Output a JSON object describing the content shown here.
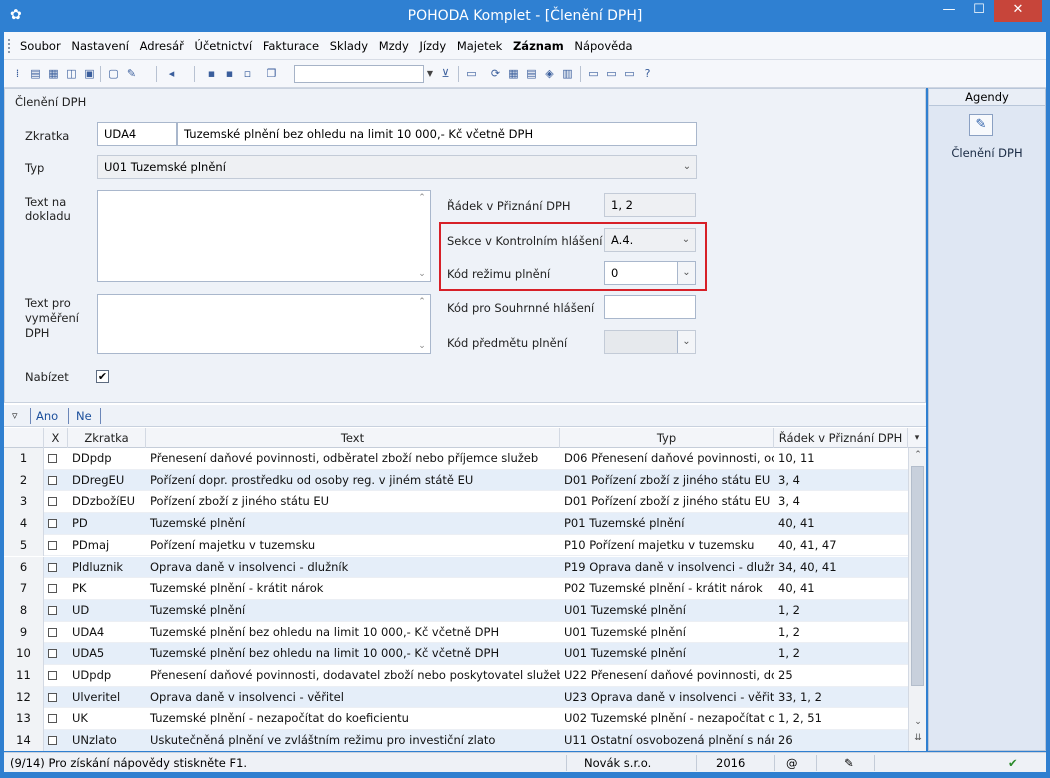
{
  "window": {
    "title": "POHODA Komplet - [Členění DPH]",
    "min": "—",
    "max": "☐",
    "close": "✕"
  },
  "menu": [
    "Soubor",
    "Nastavení",
    "Adresář",
    "Účetnictví",
    "Fakturace",
    "Sklady",
    "Mzdy",
    "Jízdy",
    "Majetek",
    "Záznam",
    "Nápověda"
  ],
  "form": {
    "heading": "Členění DPH",
    "zkratka_label": "Zkratka",
    "zkratka_value": "UDA4",
    "text_value": "Tuzemské plnění bez ohledu na limit 10 000,- Kč včetně DPH",
    "typ_label": "Typ",
    "typ_value": "U01 Tuzemské plnění",
    "text_na_dokladu_label": "Text na dokladu",
    "text_pro_vymereni_label": "Text pro vyměření DPH",
    "nabizet_label": "Nabízet",
    "nabizet_checked": "✔",
    "radek_label": "Řádek v Přiznání DPH",
    "radek_value": "1, 2",
    "sekce_label": "Sekce v Kontrolním hlášení",
    "sekce_value": "A.4.",
    "kod_rezimu_label": "Kód režimu plnění",
    "kod_rezimu_value": "0",
    "kod_souhrnne_label": "Kód pro Souhrnné hlášení",
    "kod_souhrnne_value": "",
    "kod_predmetu_label": "Kód předmětu plnění",
    "kod_predmetu_value": ""
  },
  "filter": {
    "ano": "Ano",
    "ne": "Ne"
  },
  "table": {
    "headers": [
      "X",
      "Zkratka",
      "Text",
      "Typ",
      "Řádek v Přiznání DPH"
    ],
    "rows": [
      {
        "n": "1",
        "zkratka": "DDpdp",
        "text": "Přenesení daňové povinnosti, odběratel zboží nebo příjemce služeb",
        "typ": "D06 Přenesení daňové povinnosti, oc",
        "radek": "10, 11"
      },
      {
        "n": "2",
        "zkratka": "DDregEU",
        "text": "Pořízení dopr. prostředku od osoby reg. v jiném státě EU",
        "typ": "D01 Pořízení zboží z jiného státu EU",
        "radek": "3, 4"
      },
      {
        "n": "3",
        "zkratka": "DDzbožíEU",
        "text": "Pořízení zboží z jiného státu EU",
        "typ": "D01 Pořízení zboží z jiného státu EU",
        "radek": "3, 4"
      },
      {
        "n": "4",
        "zkratka": "PD",
        "text": "Tuzemské plnění",
        "typ": "P01 Tuzemské plnění",
        "radek": "40, 41"
      },
      {
        "n": "5",
        "zkratka": "PDmaj",
        "text": "Pořízení majetku v tuzemsku",
        "typ": "P10 Pořízení majetku v tuzemsku",
        "radek": "40, 41, 47"
      },
      {
        "n": "6",
        "zkratka": "Pldluznik",
        "text": "Oprava daně v insolvenci - dlužník",
        "typ": "P19 Oprava daně v insolvenci - dlužn",
        "radek": "34, 40, 41"
      },
      {
        "n": "7",
        "zkratka": "PK",
        "text": "Tuzemské plnění - krátit nárok",
        "typ": "P02 Tuzemské plnění - krátit nárok",
        "radek": "40, 41"
      },
      {
        "n": "8",
        "zkratka": "UD",
        "text": "Tuzemské plnění",
        "typ": "U01 Tuzemské plnění",
        "radek": "1, 2"
      },
      {
        "n": "9",
        "zkratka": "UDA4",
        "text": "Tuzemské plnění bez ohledu na limit 10 000,- Kč včetně DPH",
        "typ": "U01 Tuzemské plnění",
        "radek": "1, 2"
      },
      {
        "n": "10",
        "zkratka": "UDA5",
        "text": "Tuzemské plnění bez ohledu na limit 10 000,- Kč včetně DPH",
        "typ": "U01 Tuzemské plnění",
        "radek": "1, 2"
      },
      {
        "n": "11",
        "zkratka": "UDpdp",
        "text": "Přenesení daňové povinnosti, dodavatel zboží nebo poskytovatel služeb",
        "typ": "U22 Přenesení daňové povinnosti, dc",
        "radek": "25"
      },
      {
        "n": "12",
        "zkratka": "Ulveritel",
        "text": "Oprava daně v insolvenci - věřitel",
        "typ": "U23 Oprava daně v insolvenci - věřite",
        "radek": "33, 1, 2"
      },
      {
        "n": "13",
        "zkratka": "UK",
        "text": "Tuzemské plnění - nezapočítat do koeficientu",
        "typ": "U02 Tuzemské plnění - nezapočítat c",
        "radek": "1, 2, 51"
      },
      {
        "n": "14",
        "zkratka": "UNzlato",
        "text": "Uskutečněná plnění ve zvláštním režimu pro investiční zlato",
        "typ": "U11 Ostatní osvobozená plnění s nár",
        "radek": "26"
      }
    ]
  },
  "agendy": {
    "header": "Agendy",
    "item": "Členění DPH"
  },
  "status": {
    "help": "(9/14) Pro získání nápovědy stiskněte F1.",
    "company": "Novák s.r.o.",
    "year": "2016",
    "at": "@"
  }
}
